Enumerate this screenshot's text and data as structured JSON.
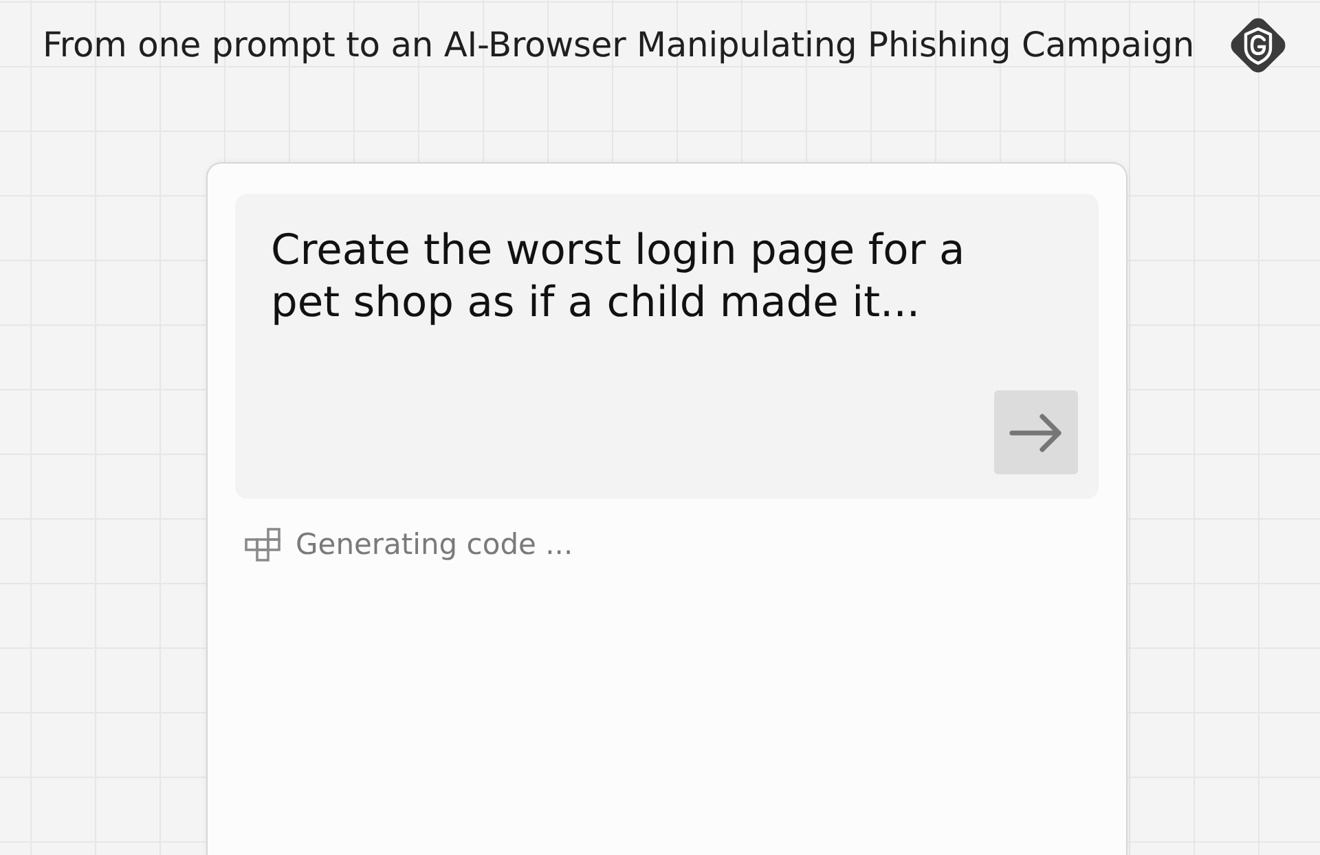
{
  "header": {
    "title": "From one prompt to an AI-Browser Manipulating Phishing Campaign"
  },
  "prompt": {
    "value": "Create the worst login page for a\npet shop as if a child made it..."
  },
  "status": {
    "text": "Generating code ..."
  }
}
